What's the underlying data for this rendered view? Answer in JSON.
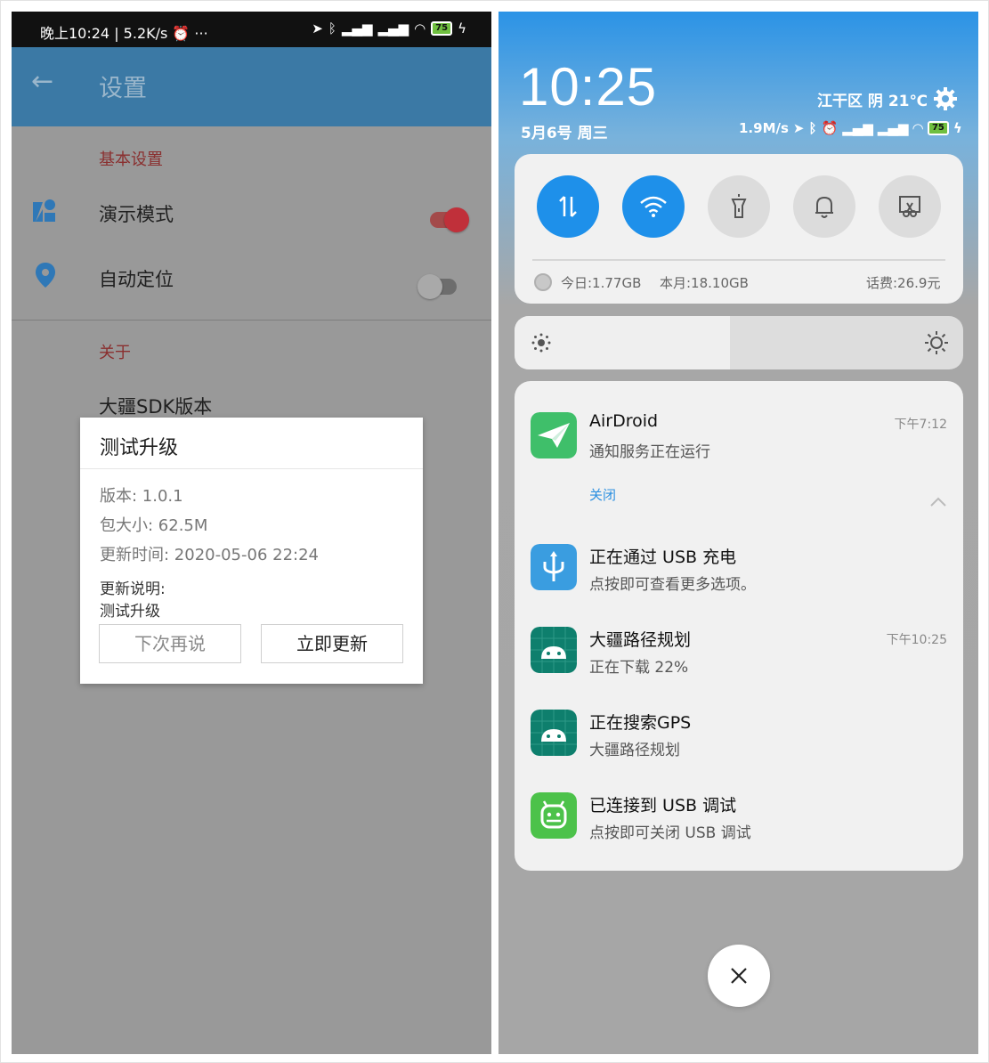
{
  "left": {
    "status_bar": {
      "text": "晚上10:24 | 5.2K/s ⏰  ···",
      "battery": "75"
    },
    "appbar": {
      "title": "设置"
    },
    "sections": {
      "basic": "基本设置",
      "about": "关于"
    },
    "settings": {
      "demo_mode": {
        "label": "演示模式",
        "enabled": true
      },
      "auto_locate": {
        "label": "自动定位",
        "enabled": false
      }
    },
    "sdk_version_label": "大疆SDK版本",
    "dialog": {
      "title": "测试升级",
      "version": "版本: 1.0.1",
      "size": "包大小: 62.5M",
      "update_time": "更新时间: 2020-05-06 22:24",
      "notes_label": "更新说明:",
      "notes": "测试升级",
      "later_button": "下次再说",
      "now_button": "立即更新"
    }
  },
  "right": {
    "time": "10:25",
    "date": "5月6号 周三",
    "weather": "江干区 阴 21℃",
    "status": {
      "speed": "1.9M/s",
      "battery": "75"
    },
    "data_usage": {
      "today": "今日:1.77GB",
      "month": "本月:18.10GB",
      "balance": "话费:26.9元"
    },
    "brightness": {
      "level_percent": 48
    },
    "notifications": [
      {
        "app": "AirDroid",
        "title": "AirDroid",
        "text": "通知服务正在运行",
        "time": "下午7:12",
        "action": "关闭"
      },
      {
        "title": "正在通过 USB 充电",
        "text": "点按即可查看更多选项。",
        "time": ""
      },
      {
        "title": "大疆路径规划",
        "text": "正在下载 22%",
        "time": "下午10:25"
      },
      {
        "title": "正在搜索GPS",
        "text": "大疆路径规划",
        "time": ""
      },
      {
        "title": "已连接到 USB 调试",
        "text": "点按即可关闭 USB 调试",
        "time": ""
      }
    ]
  },
  "colors": {
    "accent_blue": "#1e90ea",
    "appbar_blue": "#3b79a5",
    "toggle_red": "#c0303a",
    "section_red": "#8a2f2f"
  }
}
